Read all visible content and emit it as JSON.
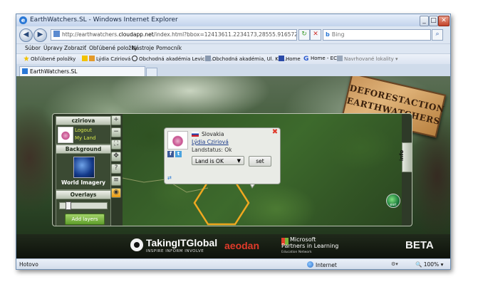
{
  "window": {
    "title": "EarthWatchers.SL - Windows Internet Explorer",
    "minimize": "_",
    "maximize": "□",
    "close": "✕"
  },
  "address": {
    "url_prefix": "http://earthwatchers.",
    "url_domain": "cloudapp.net",
    "url_suffix": "/index.html?bbox=12413611.2234173,28555.9165721835,12449667.0800",
    "search_placeholder": "Bing"
  },
  "menu": [
    "Súbor",
    "Úpravy",
    "Zobraziť",
    "Obľúbené položky",
    "Nástroje",
    "Pomocník"
  ],
  "favorites": [
    {
      "label": "Obľúbené položky",
      "icon": "star-icon"
    },
    {
      "label": "Lýdia Cziriová",
      "icon": "page-icon"
    },
    {
      "label": "Obchodná akadémia Levice ...",
      "icon": "circle-icon"
    },
    {
      "label": "Obchodná akadémia, Ul. Kál...",
      "icon": "page-icon"
    },
    {
      "label": "Home",
      "icon": "page-icon"
    },
    {
      "label": "Home - ECB",
      "icon": "g-icon"
    },
    {
      "label": "Navrhované lokality ▾",
      "icon": "page-icon"
    }
  ],
  "tab": {
    "label": "EarthWatchers.SL"
  },
  "app": {
    "user_section": "cziriova",
    "logout": "Logout",
    "my_land": "My Land",
    "background_section": "Background",
    "background_label": "World Imagery",
    "overlays_section": "Overlays",
    "add_layers": "Add layers",
    "info_tab": "info",
    "esri": "esri",
    "stamp_line1": "DEFORESTACTION",
    "stamp_line2": "EARTHWATCHERS"
  },
  "popup": {
    "country": "Slovakia",
    "name": "Lýdia Cziriová",
    "status": "Landstatus: Ok",
    "select_value": "Land is OK",
    "set_button": "set",
    "close": "✖"
  },
  "sponsors": {
    "tig_name": "TakingITGlobal",
    "tig_tagline": "INSPIRE INFORM INVOLVE",
    "aeodan": "aeodan",
    "ms_line1": "Microsoft",
    "ms_line2": "Partners in Learning",
    "ms_line3": "Education Network",
    "beta": "BETA"
  },
  "status": {
    "text": "Hotovo",
    "zone": "Internet",
    "zoom": "100%"
  }
}
